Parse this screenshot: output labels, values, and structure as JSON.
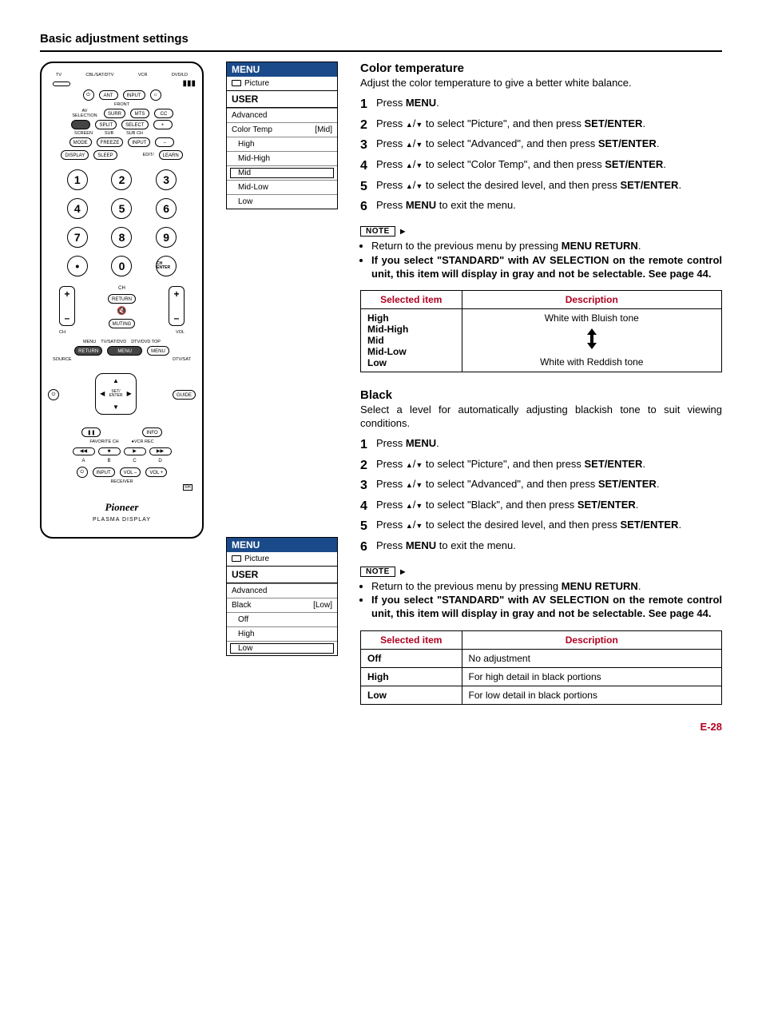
{
  "page": {
    "title": "Basic adjustment settings",
    "page_number": "E-28"
  },
  "remote": {
    "top_labels": [
      "TV",
      "CBL/SAT/DTV",
      "VCR",
      "DVD/LD"
    ],
    "power": "⏻",
    "ant": "ANT",
    "input": "INPUT",
    "light": "☼",
    "front": "FRONT",
    "av_sel": "AV SELECTION",
    "surr": "SURR",
    "mts": "MTS",
    "cc": "CC",
    "split": "SPLIT",
    "select": "SELECT",
    "plus": "+",
    "screen": "SCREEN",
    "sub": "SUB",
    "subch": "SUB CH",
    "mode": "MODE",
    "freeze": "FREEZE",
    "input2": "INPUT",
    "minus": "–",
    "display": "DISPLAY",
    "sleep": "SLEEP",
    "edit": "EDIT/",
    "learn": "LEARN",
    "nums": [
      "1",
      "2",
      "3",
      "4",
      "5",
      "6",
      "7",
      "8",
      "9",
      "•",
      "0"
    ],
    "ch_enter": "CH ENTER",
    "ch": "CH",
    "return": "RETURN",
    "mute": "🔇",
    "muting": "MUTING",
    "vol": "VOL",
    "menu_lbl": "MENU",
    "tvsatdvd": "TV/SAT/DVD",
    "dtvdvdtop": "DTV/DVD TOP",
    "return2": "RETURN",
    "menu_btn": "MENU",
    "source": "SOURCE",
    "dtvsat": "DTV/SAT",
    "guide": "GUIDE",
    "setenter": "SET/ ENTER",
    "info": "INFO",
    "pause": "❚❚",
    "favorite": "FAVORITE CH",
    "vcrrec": "●VCR REC",
    "transport": [
      "◀◀",
      "■",
      "▶",
      "▶▶"
    ],
    "abcd": [
      "A",
      "B",
      "C",
      "D"
    ],
    "rcv_power": "⏻",
    "rcv_input": "INPUT",
    "rcv_volm": "VOL –",
    "rcv_volp": "VOL +",
    "receiver": "RECEIVER",
    "sr": "SR",
    "brand": "Pioneer",
    "subbrand": "PLASMA DISPLAY"
  },
  "menu1": {
    "title": "MENU",
    "picture": "Picture",
    "user": "USER",
    "advanced": "Advanced",
    "item": "Color Temp",
    "value": "[Mid]",
    "options": [
      "High",
      "Mid-High",
      "Mid",
      "Mid-Low",
      "Low"
    ],
    "selected_index": 2
  },
  "menu2": {
    "title": "MENU",
    "picture": "Picture",
    "user": "USER",
    "advanced": "Advanced",
    "item": "Black",
    "value": "[Low]",
    "options": [
      "Off",
      "High",
      "Low"
    ],
    "selected_index": 2
  },
  "section1": {
    "heading": "Color temperature",
    "intro": "Adjust the color temperature to give a better white balance.",
    "steps": [
      {
        "pre": "Press ",
        "b": "MENU",
        "post": "."
      },
      {
        "pre": "Press ",
        "arrows": true,
        "mid": " to select \"Picture\", and then press ",
        "b": "SET/ENTER",
        "post": "."
      },
      {
        "pre": "Press ",
        "arrows": true,
        "mid": " to select \"Advanced\", and then press ",
        "b": "SET/ENTER",
        "post": "."
      },
      {
        "pre": "Press ",
        "arrows": true,
        "mid": " to select \"Color Temp\", and then press ",
        "b": "SET/ENTER",
        "post": "."
      },
      {
        "pre": "Press ",
        "arrows": true,
        "mid": " to select the desired level, and then press ",
        "b": "SET/ENTER",
        "post": "."
      },
      {
        "pre": "Press ",
        "b": "MENU",
        "post": " to exit the menu."
      }
    ],
    "note_label": "NOTE",
    "notes": [
      {
        "pre": "Return to the previous menu by pressing ",
        "b": "MENU RETURN",
        "post": "."
      },
      {
        "bold_all": "If you select \"STANDARD\" with AV SELECTION on the remote control unit, this item will display in gray and not be selectable. See page 44."
      }
    ],
    "table": {
      "h1": "Selected item",
      "h2": "Description",
      "items": [
        "High",
        "Mid-High",
        "Mid",
        "Mid-Low",
        "Low"
      ],
      "top_desc": "White with Bluish tone",
      "bottom_desc": "White with Reddish tone"
    }
  },
  "section2": {
    "heading": "Black",
    "intro": "Select a level for automatically adjusting blackish tone to suit viewing conditions.",
    "steps": [
      {
        "pre": "Press ",
        "b": "MENU",
        "post": "."
      },
      {
        "pre": "Press ",
        "arrows": true,
        "mid": " to select \"Picture\", and then press ",
        "b": "SET/ENTER",
        "post": "."
      },
      {
        "pre": "Press ",
        "arrows": true,
        "mid": " to select \"Advanced\", and then press ",
        "b": "SET/ENTER",
        "post": "."
      },
      {
        "pre": "Press ",
        "arrows": true,
        "mid": " to select \"Black\", and then press ",
        "b": "SET/ENTER",
        "post": "."
      },
      {
        "pre": "Press ",
        "arrows": true,
        "mid": " to select the desired level, and then press ",
        "b": "SET/ENTER",
        "post": "."
      },
      {
        "pre": "Press ",
        "b": "MENU",
        "post": " to exit the menu."
      }
    ],
    "note_label": "NOTE",
    "notes": [
      {
        "pre": "Return to the previous menu by pressing ",
        "b": "MENU RETURN",
        "post": "."
      },
      {
        "bold_all": "If you select \"STANDARD\" with AV SELECTION on the remote control unit, this item will display in gray and not be selectable. See page 44."
      }
    ],
    "table": {
      "h1": "Selected item",
      "h2": "Description",
      "rows": [
        {
          "sel": "Off",
          "desc": "No adjustment"
        },
        {
          "sel": "High",
          "desc": "For high detail in black portions"
        },
        {
          "sel": "Low",
          "desc": "For low detail in black portions"
        }
      ]
    }
  }
}
